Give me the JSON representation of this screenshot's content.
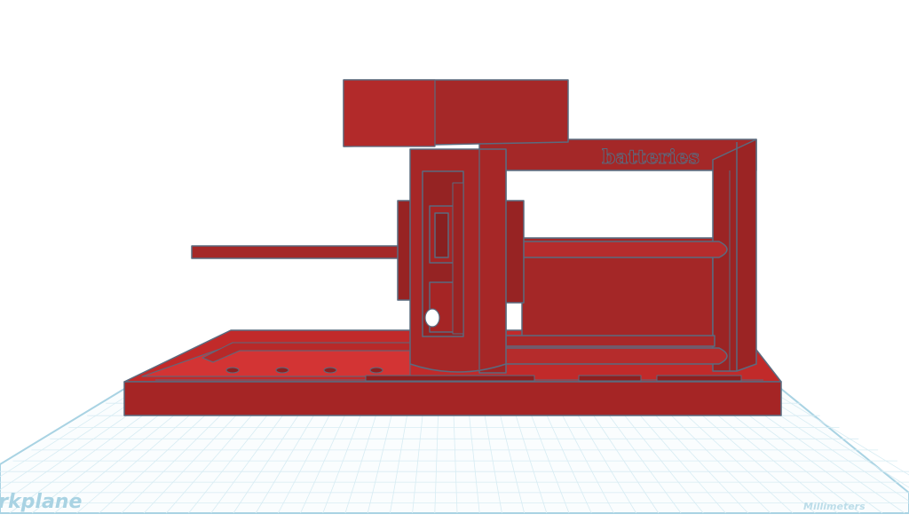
{
  "workplane": {
    "label": "Workplane",
    "units_label": "Millimeters"
  },
  "model": {
    "engraved_text": "batteries",
    "color": "#a42828",
    "edge_color": "#5a6b7f"
  },
  "grid": {
    "line_color": "#d7ecf3",
    "border_color": "#a9d3e3"
  }
}
